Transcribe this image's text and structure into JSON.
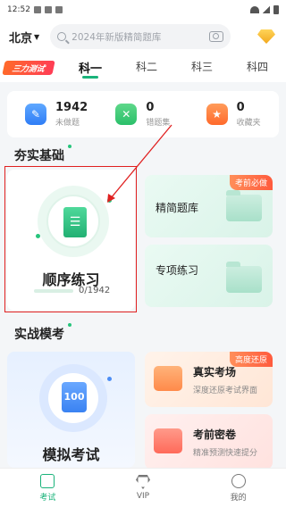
{
  "status_bar": {
    "time": "12:52"
  },
  "header": {
    "city": "北京",
    "search_placeholder": "2024年新版精简题库",
    "icons": [
      "search-icon",
      "camera-icon",
      "vip-diamond-icon"
    ]
  },
  "brand": {
    "label": "三力测试"
  },
  "tabs": [
    {
      "label": "科一",
      "active": true
    },
    {
      "label": "科二",
      "active": false
    },
    {
      "label": "科三",
      "active": false
    },
    {
      "label": "科四",
      "active": false
    }
  ],
  "stats": [
    {
      "value": "1942",
      "label": "未做题",
      "icon": "pencil-icon"
    },
    {
      "value": "0",
      "label": "错题集",
      "icon": "wrong-icon"
    },
    {
      "value": "0",
      "label": "收藏夹",
      "icon": "star-icon"
    }
  ],
  "section_basics": {
    "title": "夯实基础"
  },
  "sequential": {
    "title": "顺序练习",
    "progress_text": "0/1942",
    "progress_fraction": 0
  },
  "simplified_bank": {
    "title": "精简题库",
    "badge": "考前必做"
  },
  "special_practice": {
    "title": "专项练习"
  },
  "section_mock": {
    "title": "实战模考"
  },
  "mock_exam": {
    "title": "模拟考试",
    "doc_label": "100"
  },
  "real_exam": {
    "title": "真实考场",
    "subtitle": "深度还原考试界面",
    "badge": "高度还原"
  },
  "secret_paper": {
    "title": "考前密卷",
    "subtitle": "精准预测快速提分"
  },
  "bottom_nav": [
    {
      "label": "考试",
      "icon": "exam-icon",
      "active": true
    },
    {
      "label": "VIP",
      "icon": "vip-icon",
      "active": false
    },
    {
      "label": "我的",
      "icon": "profile-icon",
      "active": false
    }
  ],
  "colors": {
    "accent": "#19b37a",
    "highlight": "#e02020"
  }
}
